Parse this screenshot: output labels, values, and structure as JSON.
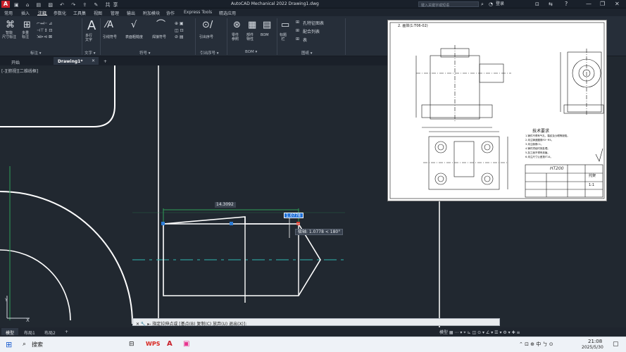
{
  "titlebar": {
    "logo": "A",
    "qat_icons": "▣ ⌂ ▤ ▧ ↶ ↷ ⇪ ✎ 共享",
    "title": "AutoCAD Mechanical 2022   Drawing1.dwg",
    "search_placeholder": "键入关键字或短语",
    "user": "登录",
    "minimize": "—",
    "restore": "❐",
    "close": "✕"
  },
  "ribbon_tabs": [
    "常用",
    "插入",
    "注释",
    "参数化",
    "工具集",
    "视图",
    "管理",
    "输出",
    "附加模块",
    "协作",
    "Express Tools",
    "精选应用"
  ],
  "ribbon_active_tab": "注释",
  "ribbon": {
    "groups": [
      {
        "label": "标注 ▾",
        "items": [
          "智能\n尺寸标注",
          "多重\n标注"
        ]
      },
      {
        "label": "文字 ▾",
        "items": [
          "多行\n文字"
        ]
      },
      {
        "label": "符号 ▾",
        "items": [
          "引线符号",
          "表面粗糙度",
          "焊接符号"
        ]
      },
      {
        "label": "引出序号 ▾",
        "items": [
          "引出序号"
        ]
      },
      {
        "label": "BOM ▾",
        "items": [
          "零件\n参照",
          "部件\n特性",
          "BOM"
        ]
      },
      {
        "label": "图纸 ▾",
        "items": [
          "标题\n栏",
          "孔特征图表",
          "配合列表",
          "表"
        ]
      }
    ],
    "small_right": [
      "孔特征图表",
      "配合列表",
      "表"
    ]
  },
  "doc_tabs": [
    "开始",
    "Drawing1*",
    "+"
  ],
  "doc_active": "Drawing1*",
  "view_label": "[-][俯视][二维线框]",
  "dimensions": {
    "length_box": "14.3092",
    "input_box": "1.0778",
    "tooltip": "极轴: 1.0778 < 180°"
  },
  "command_line": "✕ 🔧 ▸- 指定拉伸点或 [基点(B) 复制(C) 放弃(U) 退出(X)]:",
  "layout_tabs": [
    "模型",
    "布局1",
    "布局2",
    "+"
  ],
  "layout_active": "模型",
  "status_icons": "模型 ▦ ⋯ ▾ ⌖ ⊾ ◫ ⊙ ▾ ∠ ▾ ☰ ▾ ⚙ ▾ ✚ ≡",
  "taskbar": {
    "start": "⊞",
    "search_label": "搜索",
    "apps": [
      "WPS",
      "A",
      "▣"
    ],
    "tray": "⌃ ⊡ ⊕ 中 ㄅ ⊙",
    "time": "21:08",
    "date": "2025/5/30"
  },
  "reference_image": {
    "heading": "2. 画体(1:T06-02)",
    "tech_title": "技术要求",
    "tech_lines": [
      "1.铸件不得有气孔、裂纹及沙眼等缺陷。",
      "2.未注铸造圆角R3~R5。",
      "3.未注倒角C1。",
      "4.铸件须经时效处理。",
      "5.加工面不得有划痕。",
      "6.未注尺寸公差按IT14。"
    ],
    "title_block_material": "HT200",
    "title_block_name": "托架",
    "title_block_scale": "1:1"
  }
}
